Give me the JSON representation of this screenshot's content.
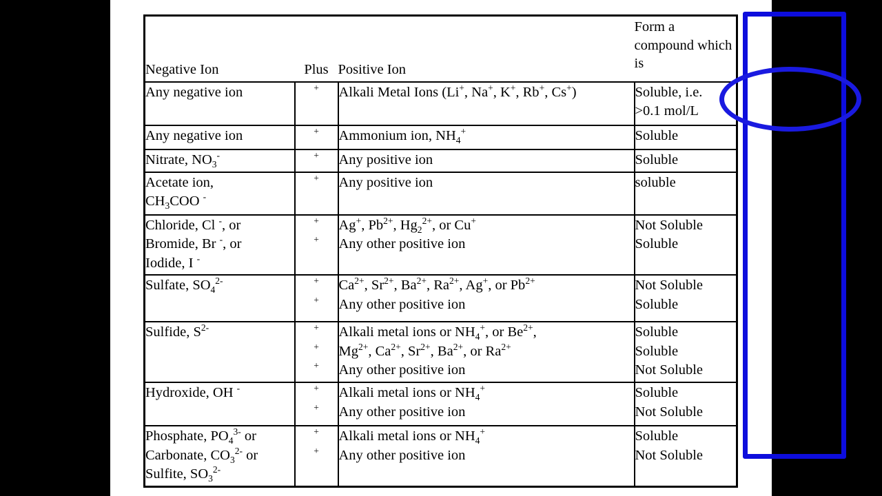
{
  "slide": {
    "background": "#ffffff",
    "letterbox_color": "#000000"
  },
  "annotations": {
    "highlight_color": "#0d0ddd",
    "rectangle_label": "blue-rectangle-around-result-column",
    "ellipse_label": "blue-ellipse-around-soluble-definition"
  },
  "table": {
    "headers": {
      "negative_ion": "Negative Ion",
      "plus": "Plus",
      "positive_ion": "Positive Ion",
      "result": "Form a compound which is"
    },
    "rows": [
      {
        "negative_ion": [
          [
            "Any negative ion"
          ]
        ],
        "plus": [
          "+"
        ],
        "positive_ion": [
          [
            "Alkali Metal Ions (Li",
            "+",
            ", Na",
            "+",
            ", K",
            "+",
            ", Rb",
            "+",
            ", Cs",
            "+",
            ")"
          ]
        ],
        "result": [
          "Soluble, i.e.",
          ">0.1 mol/L"
        ]
      },
      {
        "negative_ion": [
          [
            "Any negative ion"
          ]
        ],
        "plus": [
          "+"
        ],
        "positive_ion": [
          [
            "Ammonium ion, NH",
            "4",
            "+"
          ]
        ],
        "result": [
          "Soluble"
        ]
      },
      {
        "negative_ion": [
          [
            "Nitrate, NO",
            "3",
            "-"
          ]
        ],
        "plus": [
          "+"
        ],
        "positive_ion": [
          [
            "Any positive ion"
          ]
        ],
        "result": [
          "Soluble"
        ]
      },
      {
        "negative_ion": [
          [
            "Acetate ion,"
          ],
          [
            "CH",
            "3",
            "COO ",
            "-"
          ]
        ],
        "plus": [
          "+"
        ],
        "positive_ion": [
          [
            "Any positive ion"
          ]
        ],
        "result": [
          "soluble"
        ]
      },
      {
        "negative_ion": [
          [
            "Chloride, Cl ",
            "-",
            ", or"
          ],
          [
            "Bromide, Br ",
            "-",
            ", or"
          ],
          [
            "Iodide, I ",
            "-"
          ]
        ],
        "plus": [
          "+",
          "+"
        ],
        "positive_ion": [
          [
            "Ag",
            "+",
            ", Pb",
            "2+",
            ", Hg",
            "2",
            "2+",
            ", or Cu",
            "+"
          ],
          [
            "Any other positive ion"
          ]
        ],
        "result": [
          "Not Soluble",
          "Soluble"
        ]
      },
      {
        "negative_ion": [
          [
            "Sulfate, SO",
            "4",
            "2-"
          ]
        ],
        "plus": [
          "+",
          "+"
        ],
        "positive_ion": [
          [
            "Ca",
            "2+",
            ", Sr",
            "2+",
            ", Ba",
            "2+",
            ", Ra",
            "2+",
            ", Ag",
            "+",
            ", or Pb",
            "2+"
          ],
          [
            "Any other positive ion"
          ]
        ],
        "result": [
          "Not Soluble",
          "Soluble"
        ]
      },
      {
        "negative_ion": [
          [
            "Sulfide, S",
            "2-"
          ]
        ],
        "plus": [
          "+",
          "+",
          "+"
        ],
        "positive_ion": [
          [
            "Alkali metal ions or NH",
            "4",
            "+",
            ", or Be",
            "2+",
            ","
          ],
          [
            "Mg",
            "2+",
            ", Ca",
            "2+",
            ", Sr",
            "2+",
            ", Ba",
            "2+",
            ", or Ra",
            "2+"
          ],
          [
            "Any other positive ion"
          ]
        ],
        "result": [
          "Soluble",
          "Soluble",
          "Not Soluble"
        ]
      },
      {
        "negative_ion": [
          [
            "Hydroxide, OH ",
            "-"
          ]
        ],
        "plus": [
          "+",
          "+"
        ],
        "positive_ion": [
          [
            "Alkali metal ions or NH",
            "4",
            "+"
          ],
          [
            "Any other positive ion"
          ]
        ],
        "result": [
          "Soluble",
          "Not Soluble"
        ]
      },
      {
        "negative_ion": [
          [
            "Phosphate, PO",
            "4",
            "3-",
            "  or"
          ],
          [
            "Carbonate, CO",
            "3",
            "2-",
            "  or"
          ],
          [
            "Sulfite, SO",
            "3",
            "2-"
          ]
        ],
        "plus": [
          "+",
          "+"
        ],
        "positive_ion": [
          [
            "Alkali metal ions or NH",
            "4",
            "+"
          ],
          [
            "Any other positive ion"
          ]
        ],
        "result": [
          "Soluble",
          "Not Soluble"
        ]
      }
    ]
  }
}
